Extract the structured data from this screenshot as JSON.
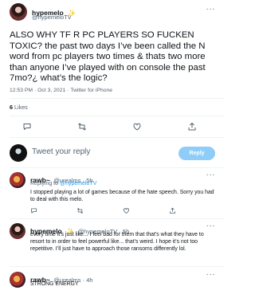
{
  "tweet": {
    "author_name": "hypemelo",
    "author_badge": "✨",
    "author_handle": "@hypemeloTV",
    "more_label": "···",
    "text": "ALSO WHY TF R PC PLAYERS SO FUCKEN TOXIC? the past two days I’ve been called the N word from pc players two times & thats two more than anyone I’ve played with on console the past 7mo?¿ what’s the logic?",
    "timestamp": "12:53 PM · Oct 3, 2021 · Twitter for iPhone",
    "likes_count": "6",
    "likes_label": "Likes"
  },
  "reply_box": {
    "placeholder": "Tweet your reply",
    "button_label": "Reply"
  },
  "replies": [
    {
      "name": "rawb~",
      "handle": "@urealms · 5h",
      "replying_prefix": "Replying to ",
      "replying_to": "@hypemeloTV",
      "text": "I stopped playing a lot of games because of the hate speech. Sorry you had to deal with this melo.",
      "more_label": "···"
    },
    {
      "name": "hypemelo",
      "badge": "✨",
      "handle": "@hypemeloTV · 5h",
      "text": "every time it’s just like... I feel bad for them that that’s what they have to resort to in order to feel powerful like... that’s weird. I hope it’s not too repetitive. I’ll just have to approach those ransoms differently lol.",
      "more_label": "···"
    },
    {
      "name": "rawb~",
      "handle": "@urealms · 4h",
      "text": "STRONG ENERGY",
      "more_label": "···"
    }
  ],
  "icons": {
    "reply": "comment-icon",
    "retweet": "retweet-icon",
    "like": "heart-icon",
    "share": "share-icon"
  },
  "colors": {
    "accent": "#1d9bf0",
    "reply_button": "#8ecdf8",
    "verified_badge": "#f2a10f"
  }
}
